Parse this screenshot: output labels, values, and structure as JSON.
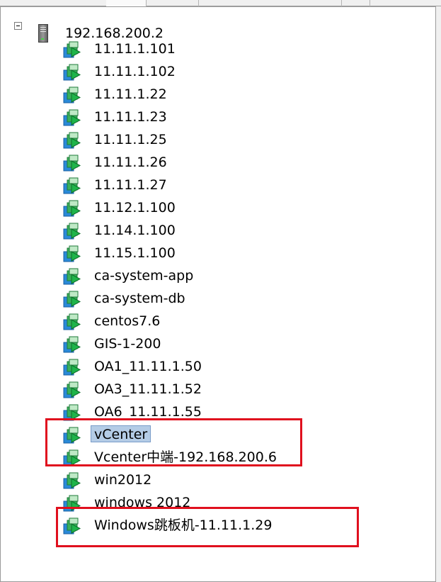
{
  "tree": {
    "root": {
      "label": "192.168.200.2",
      "expanded": true,
      "icon": "server-icon"
    },
    "vms": [
      {
        "label": "11.11.1.101",
        "icon": "vm-icon"
      },
      {
        "label": "11.11.1.102",
        "icon": "vm-icon"
      },
      {
        "label": "11.11.1.22",
        "icon": "vm-icon"
      },
      {
        "label": "11.11.1.23",
        "icon": "vm-icon"
      },
      {
        "label": "11.11.1.25",
        "icon": "vm-icon"
      },
      {
        "label": "11.11.1.26",
        "icon": "vm-icon"
      },
      {
        "label": "11.11.1.27",
        "icon": "vm-icon"
      },
      {
        "label": "11.12.1.100",
        "icon": "vm-icon"
      },
      {
        "label": "11.14.1.100",
        "icon": "vm-icon"
      },
      {
        "label": "11.15.1.100",
        "icon": "vm-icon"
      },
      {
        "label": "ca-system-app",
        "icon": "vm-icon"
      },
      {
        "label": "ca-system-db",
        "icon": "vm-icon"
      },
      {
        "label": "centos7.6",
        "icon": "vm-icon"
      },
      {
        "label": "GIS-1-200",
        "icon": "vm-icon"
      },
      {
        "label": "OA1_11.11.1.50",
        "icon": "vm-icon"
      },
      {
        "label": "OA3_11.11.1.52",
        "icon": "vm-icon"
      },
      {
        "label": "OA6_11.11.1.55",
        "icon": "vm-icon"
      },
      {
        "label": "vCenter",
        "icon": "vm-icon",
        "selected": true
      },
      {
        "label": "Vcenter中端-192.168.200.6",
        "icon": "vm-icon"
      },
      {
        "label": "win2012",
        "icon": "vm-icon"
      },
      {
        "label": "windows 2012",
        "icon": "vm-icon"
      },
      {
        "label": "Windows跳板机-11.11.1.29",
        "icon": "vm-icon"
      }
    ]
  },
  "colors": {
    "highlight_box": "#e0101e",
    "selection_bg": "#b4cce6",
    "vm_icon_green": "#1fb44a",
    "vm_icon_blue": "#2a8ad8"
  }
}
